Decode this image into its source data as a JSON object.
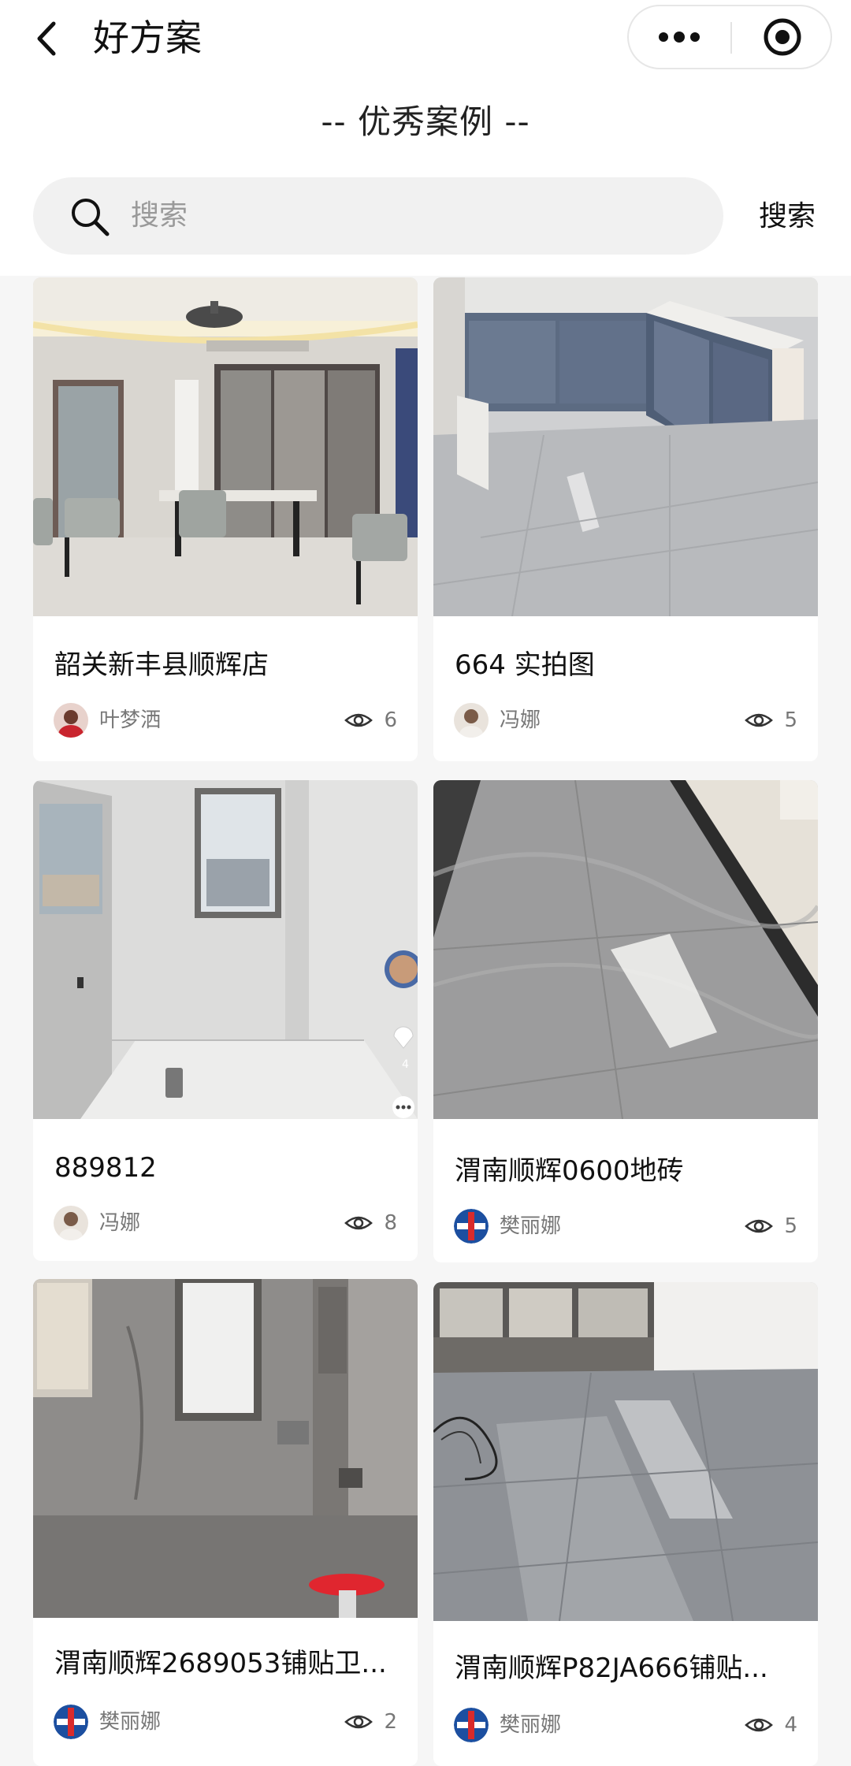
{
  "header": {
    "title": "好方案",
    "back_icon": "chevron-left-icon",
    "more_icon": "more-dots-icon",
    "close_icon": "target-close-icon"
  },
  "section": {
    "title": "-- 优秀案例 --"
  },
  "search": {
    "placeholder": "搜索",
    "value": "",
    "button_label": "搜索",
    "icon": "search-icon"
  },
  "cases": [
    {
      "title": "韶关新丰县顺辉店",
      "author": "叶梦洒",
      "views": "6",
      "photo": "dining-room"
    },
    {
      "title": "664 实拍图",
      "author": "冯娜",
      "views": "5",
      "photo": "kitchen-cabinets"
    },
    {
      "title": "889812",
      "author": "冯娜",
      "views": "8",
      "photo": "bathroom-window"
    },
    {
      "title": "渭南顺辉0600地砖",
      "author": "樊丽娜",
      "views": "5",
      "photo": "marble-floor"
    },
    {
      "title": "渭南顺辉2689053铺贴卫...",
      "author": "樊丽娜",
      "views": "2",
      "photo": "bathroom-grey"
    },
    {
      "title": "渭南顺辉P82JA666铺贴...",
      "author": "樊丽娜",
      "views": "4",
      "photo": "living-room-floor"
    }
  ],
  "colors": {
    "page_background": "#f6f6f6",
    "card_background": "#ffffff",
    "search_background": "#f1f1f1",
    "meta_text": "#777777"
  }
}
